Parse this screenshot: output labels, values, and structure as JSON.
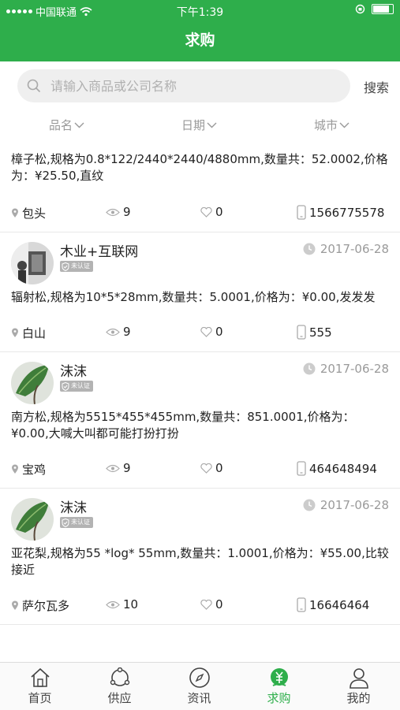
{
  "status_bar": {
    "carrier": "中国联通",
    "time": "下午1:39"
  },
  "header": {
    "title": "求购"
  },
  "search": {
    "placeholder": "请输入商品或公司名称",
    "button": "搜索"
  },
  "filters": [
    "品名",
    "日期",
    "城市"
  ],
  "items": [
    {
      "desc": "樟子松,规格为0.8*122/2440*2440/4880mm,数量共：52.0002,价格为：¥25.50,直纹",
      "city": "包头",
      "views": "9",
      "likes": "0",
      "phone": "1566775578"
    },
    {
      "user": "木业+互联网",
      "badge": "未认证",
      "date": "2017-06-28",
      "desc": "辐射松,规格为10*5*28mm,数量共：5.0001,价格为：¥0.00,发发发",
      "city": "白山",
      "views": "9",
      "likes": "0",
      "phone": "555"
    },
    {
      "user": "沫沫",
      "badge": "未认证",
      "date": "2017-06-28",
      "desc": "南方松,规格为5515*455*455mm,数量共：851.0001,价格为：¥0.00,大喊大叫都可能打扮打扮",
      "city": "宝鸡",
      "views": "9",
      "likes": "0",
      "phone": "464648494"
    },
    {
      "user": "沫沫",
      "badge": "未认证",
      "date": "2017-06-28",
      "desc": "亚花梨,规格为55 *log* 55mm,数量共：1.0001,价格为：¥55.00,比较接近",
      "city": "萨尔瓦多",
      "views": "10",
      "likes": "0",
      "phone": "16646464"
    }
  ],
  "tabs": [
    {
      "label": "首页",
      "icon": "home-icon"
    },
    {
      "label": "供应",
      "icon": "supply-icon"
    },
    {
      "label": "资讯",
      "icon": "compass-icon"
    },
    {
      "label": "求购",
      "icon": "purchase-icon",
      "active": true
    },
    {
      "label": "我的",
      "icon": "user-icon"
    }
  ],
  "colors": {
    "brand": "#2eae4b",
    "muted": "#9a9a9a"
  }
}
